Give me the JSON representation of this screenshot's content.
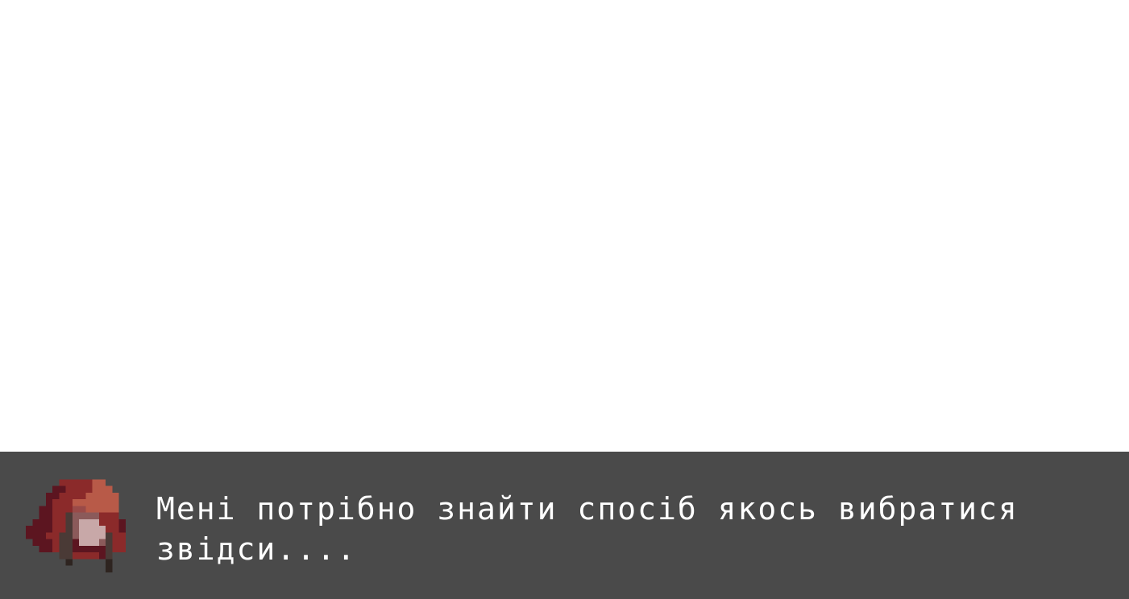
{
  "dialog": {
    "text": "Мені потрібно знайти спосіб якось вибратися\nзвідси...."
  },
  "colors": {
    "scene_background": "#ffffff",
    "dialog_background": "#4a4a4a",
    "dialog_text": "#ffffff",
    "hood_dark": "#5c1520",
    "hood_mid": "#8b2a2a",
    "hood_light": "#b85a48",
    "face": "#c8a8a8",
    "hair": "#4a3a36"
  },
  "portrait": {
    "icon": "hooded-character-portrait-icon"
  }
}
